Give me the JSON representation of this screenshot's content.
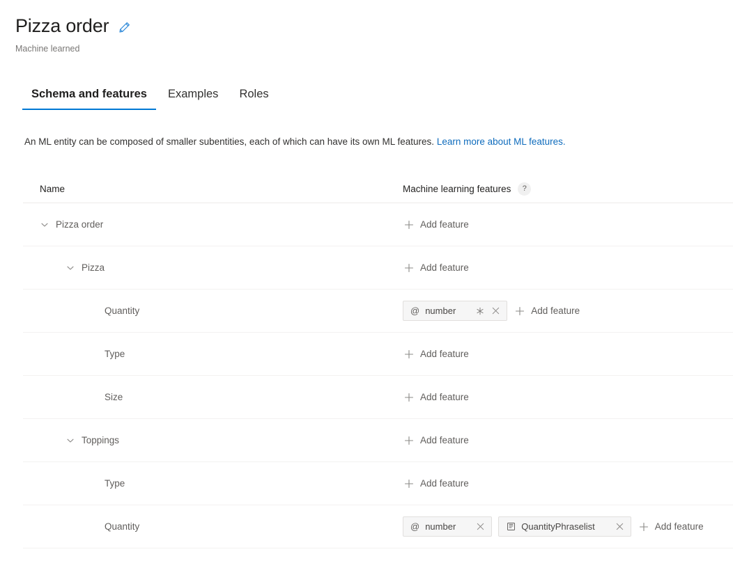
{
  "header": {
    "title": "Pizza order",
    "edit_icon": "pencil-icon",
    "subtitle": "Machine learned",
    "accent_color": "#0078d4",
    "edit_icon_color": "#2b88d8"
  },
  "tabs": [
    {
      "label": "Schema and features",
      "active": true
    },
    {
      "label": "Examples",
      "active": false
    },
    {
      "label": "Roles",
      "active": false
    }
  ],
  "description": {
    "text": "An ML entity can be composed of smaller subentities, each of which can have its own ML features. ",
    "link_text": "Learn more about ML features.",
    "link_color": "#0f6cbd"
  },
  "table": {
    "columns": {
      "name": "Name",
      "features": "Machine learning features",
      "help_icon": "question-mark-icon"
    },
    "add_feature_label": "Add feature",
    "rows": [
      {
        "name": "Pizza order",
        "level": 0,
        "expandable": true,
        "chevron": "chevron-down-icon",
        "chips": []
      },
      {
        "name": "Pizza",
        "level": 1,
        "expandable": true,
        "chevron": "chevron-down-icon",
        "chips": []
      },
      {
        "name": "Quantity",
        "level": 2,
        "expandable": false,
        "chips": [
          {
            "prefix": "@",
            "icon": "at-sign-icon",
            "label": "number",
            "required": true,
            "star": "asterisk-icon",
            "close": "close-icon"
          }
        ]
      },
      {
        "name": "Type",
        "level": 2,
        "expandable": false,
        "chips": []
      },
      {
        "name": "Size",
        "level": 2,
        "expandable": false,
        "chips": []
      },
      {
        "name": "Toppings",
        "level": 1,
        "expandable": true,
        "chevron": "chevron-down-icon",
        "chips": []
      },
      {
        "name": "Type",
        "level": 2,
        "expandable": false,
        "chips": []
      },
      {
        "name": "Quantity",
        "level": 2,
        "expandable": false,
        "chips": [
          {
            "prefix": "@",
            "icon": "at-sign-icon",
            "label": "number",
            "required": false,
            "close": "close-icon"
          },
          {
            "prefix": "",
            "icon": "phraselist-icon",
            "label": "QuantityPhraselist",
            "required": false,
            "close": "close-icon"
          }
        ]
      }
    ]
  }
}
